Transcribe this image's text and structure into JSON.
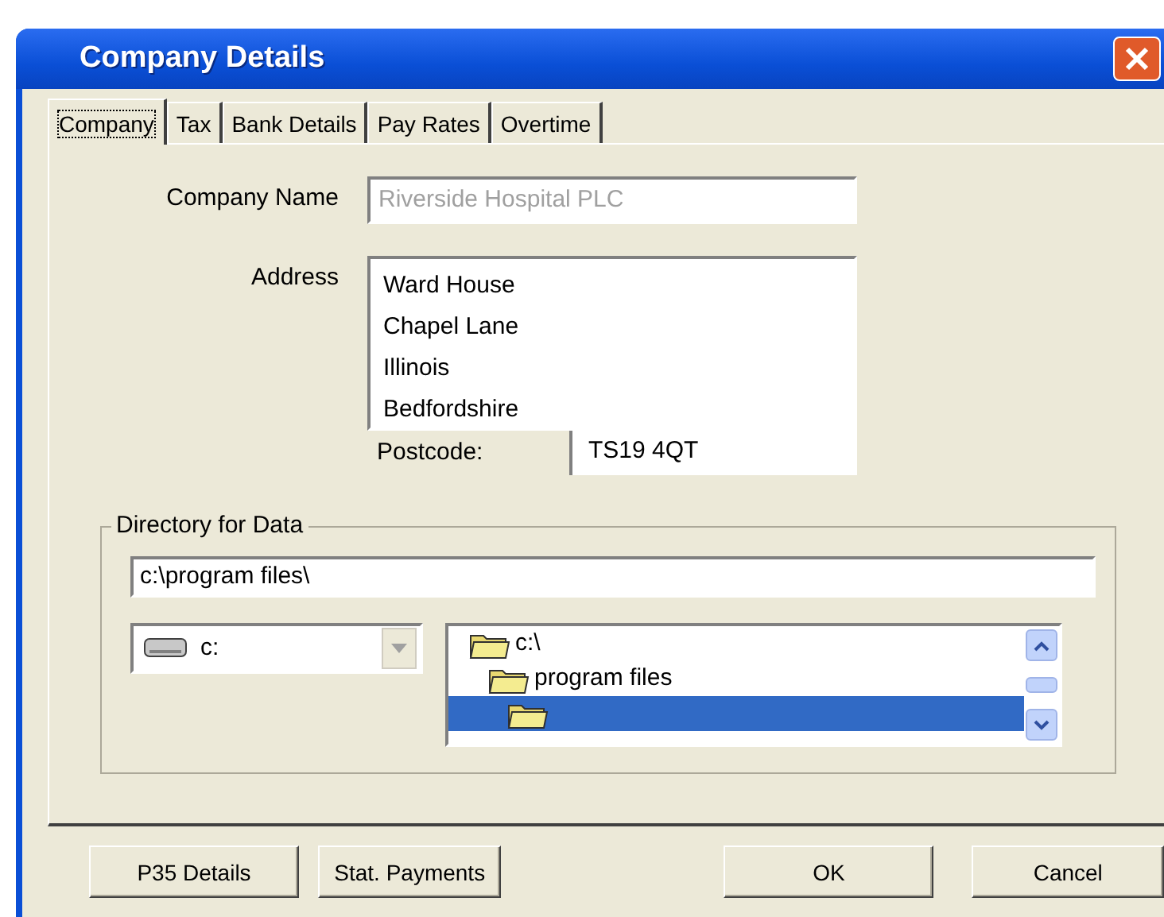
{
  "window": {
    "title": "Company Details"
  },
  "tabs": [
    {
      "label": "Company",
      "selected": true
    },
    {
      "label": "Tax",
      "selected": false
    },
    {
      "label": "Bank Details",
      "selected": false
    },
    {
      "label": "Pay Rates",
      "selected": false
    },
    {
      "label": "Overtime",
      "selected": false
    }
  ],
  "company_name": {
    "label": "Company Name",
    "value": "Riverside Hospital PLC",
    "disabled": true
  },
  "address": {
    "label": "Address",
    "lines": [
      "Ward House",
      "Chapel Lane",
      "Illinois",
      "Bedfordshire"
    ]
  },
  "postcode": {
    "label": "Postcode:",
    "value": "TS19 4QT"
  },
  "directory": {
    "label": "Directory for Data",
    "path": "c:\\program files\\",
    "drive": "c:",
    "folders": [
      {
        "label": "c:\\",
        "selected": false,
        "children": [
          {
            "label": "program files",
            "selected": false,
            "children": [
              {
                "selected": true
              }
            ]
          }
        ]
      }
    ]
  },
  "buttons": [
    {
      "label": "P35 Details"
    },
    {
      "label": "Stat. Payments"
    },
    {
      "label": "OK"
    },
    {
      "label": "Cancel"
    }
  ]
}
